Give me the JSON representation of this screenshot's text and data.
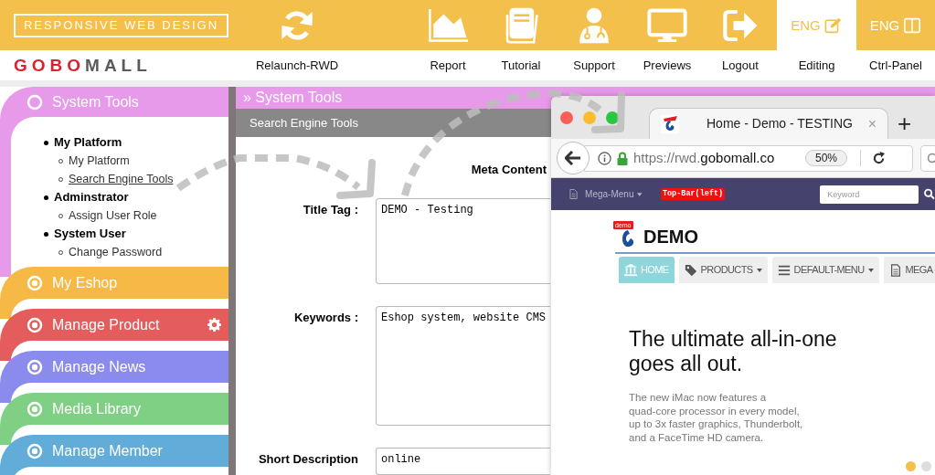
{
  "header": {
    "banner": "RESPONSIVE WEB DESIGN",
    "logo": [
      {
        "text": "GOBO",
        "color": "#d9232d"
      },
      {
        "text": "MALL",
        "color": "#5a5a5a"
      }
    ],
    "nav": [
      {
        "label": "Relaunch-RWD",
        "selected": false
      },
      {
        "label": "Report",
        "selected": false
      },
      {
        "label": "Tutorial",
        "selected": false
      },
      {
        "label": "Support",
        "selected": false
      },
      {
        "label": "Previews",
        "selected": false
      },
      {
        "label": "Logout",
        "selected": false
      },
      {
        "label": "Editing",
        "lang": "ENG",
        "selected": true
      },
      {
        "label": "Ctrl-Panel",
        "lang": "ENG",
        "selected": false
      }
    ]
  },
  "sidebar": {
    "sections": [
      {
        "label": "System Tools",
        "color": "#e79ae9",
        "expanded": true,
        "gear": false,
        "children": [
          {
            "label": "My Platform",
            "children": [
              {
                "label": "My Platform",
                "selected": false
              },
              {
                "label": "Search Engine Tools",
                "selected": true
              }
            ]
          },
          {
            "label": "Adminstrator",
            "children": [
              {
                "label": "Assign User Role",
                "selected": false
              }
            ]
          },
          {
            "label": "System User",
            "children": [
              {
                "label": "Change Password",
                "selected": false
              }
            ]
          }
        ]
      },
      {
        "label": "My Eshop",
        "color": "#f6b945",
        "expanded": false,
        "gear": false
      },
      {
        "label": "Manage Product",
        "color": "#e55c5c",
        "expanded": false,
        "gear": true
      },
      {
        "label": "Manage News",
        "color": "#8a8bec",
        "expanded": false,
        "gear": false
      },
      {
        "label": "Media Library",
        "color": "#7fcf85",
        "expanded": false,
        "gear": false
      },
      {
        "label": "Manage Member",
        "color": "#62acd9",
        "expanded": false,
        "gear": false
      }
    ]
  },
  "panel": {
    "title": "» System Tools",
    "subtitle": "Search Engine Tools",
    "section": "Meta Content",
    "fields": [
      {
        "label": "Title Tag :",
        "value": "DEMO - Testing",
        "kind": "textarea"
      },
      {
        "label": "Keywords :",
        "value": "Eshop system, website CMS",
        "kind": "textarea"
      },
      {
        "label": "Short Description",
        "value": "online",
        "kind": "input"
      }
    ]
  },
  "browser": {
    "tab": {
      "title": "Home - Demo - TESTING",
      "close": "×"
    },
    "new_tab": "+",
    "url": {
      "prefix": "https://rwd.",
      "domain": "gobomall.co"
    },
    "zoom": "50%",
    "site": {
      "topbar": {
        "menu": "Mega-Menu",
        "badge": "Top-Bar(left)",
        "search_placeholder": "Keyword"
      },
      "logo": {
        "ribbon": "demo",
        "name": "DEMO"
      },
      "menu": [
        {
          "label": "HOME",
          "dropdown": false,
          "selected": true
        },
        {
          "label": "PRODUCTS",
          "dropdown": true,
          "selected": false
        },
        {
          "label": "DEFAULT-MENU",
          "dropdown": true,
          "selected": false
        },
        {
          "label": "MEGA",
          "dropdown": false,
          "selected": false
        }
      ],
      "hero": {
        "headline": [
          "The ultimate all-in-one",
          "goes all out."
        ],
        "body": [
          "The new iMac now features a",
          "quad-core processor in every model,",
          "up to 3x faster graphics, Thunderbolt,",
          "and a FaceTime HD camera."
        ]
      },
      "slides": [
        {
          "selected": true
        },
        {
          "selected": false
        }
      ]
    }
  }
}
